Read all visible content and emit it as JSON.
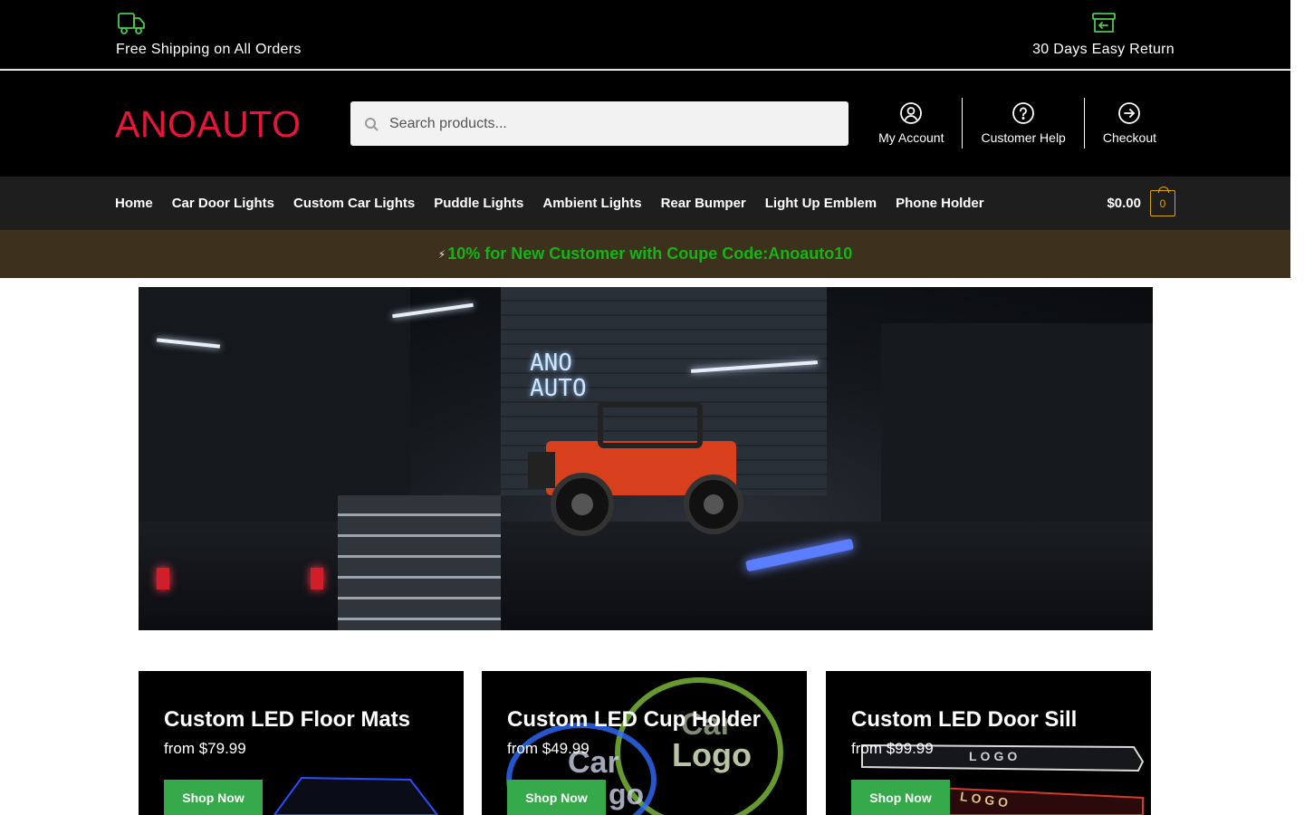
{
  "topbar": {
    "shipping_text": "Free Shipping on All Orders",
    "shipping_icon": "truck-icon",
    "return_text": "30 Days Easy Return",
    "return_icon": "return-box-icon"
  },
  "header": {
    "logo": "ANOAUTO",
    "search_placeholder": "Search products...",
    "links": [
      {
        "label": "My Account",
        "icon": "user-icon"
      },
      {
        "label": "Customer Help",
        "icon": "help-icon"
      },
      {
        "label": "Checkout",
        "icon": "arrow-right-circle-icon"
      }
    ]
  },
  "nav": {
    "items": [
      "Home",
      "Car Door Lights",
      "Custom Car Lights",
      "Puddle Lights",
      "Ambient Lights",
      "Rear Bumper",
      "Light Up Emblem",
      "Phone Holder"
    ],
    "cart_amount": "$0.00",
    "cart_count": "0"
  },
  "promo": {
    "bolt": "⚡",
    "text": "10% for New Customer with Coupe Code:Anoauto10"
  },
  "hero": {
    "sign_line1": "ANO",
    "sign_line2": "AUTO"
  },
  "products": [
    {
      "title": "Custom LED Floor Mats",
      "price": "from $79.99",
      "button": "Shop Now"
    },
    {
      "title": "Custom LED Cup Holder",
      "price": "from $49.99",
      "button": "Shop Now",
      "art_text1": "Car",
      "art_text2": "Logo",
      "art_text3": "Car",
      "art_text4": "go"
    },
    {
      "title": "Custom LED Door Sill",
      "price": "from $99.99",
      "button": "Shop Now",
      "art_text1": "LOGO",
      "art_text2": "LOGO"
    }
  ],
  "colors": {
    "brand_red": "#e6163b",
    "promo_green": "#14b414",
    "button_green": "#36a94a",
    "cart_gold": "#d6a700"
  }
}
